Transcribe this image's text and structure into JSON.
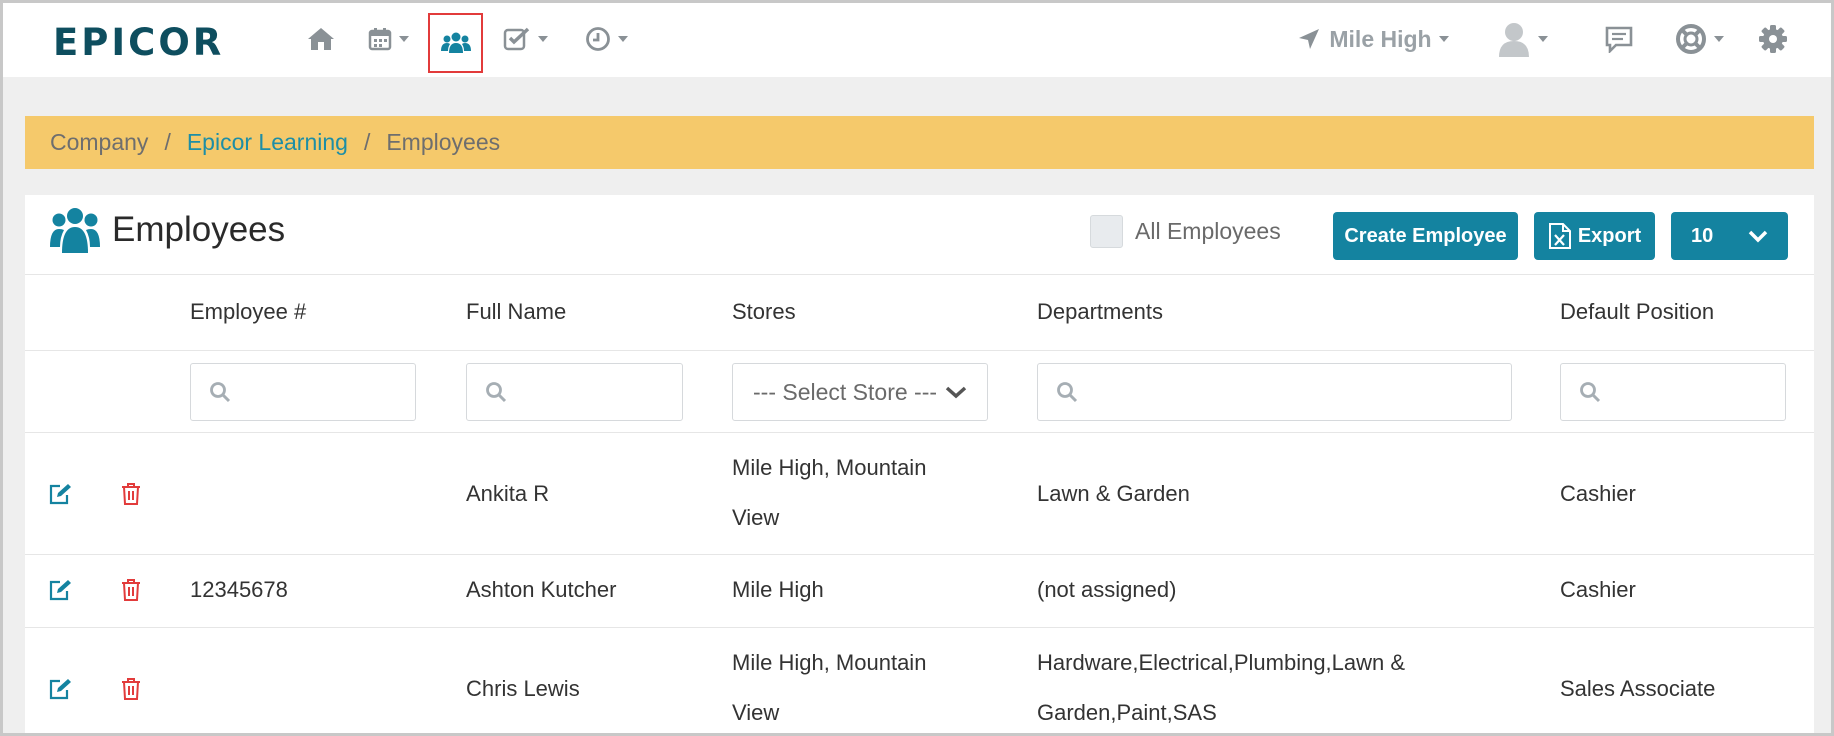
{
  "navbar": {
    "logo": "EPICOR",
    "store": "Mile High",
    "icons": [
      "home-icon",
      "calendar-icon",
      "users-icon",
      "tasks-icon",
      "clock-icon",
      "location-arrow-icon",
      "user-avatar-icon",
      "chat-icon",
      "support-icon",
      "gear-icon"
    ]
  },
  "breadcrumb": {
    "items": [
      "Company",
      "Epicor Learning",
      "Employees"
    ]
  },
  "panel": {
    "title": "Employees",
    "all_employees_label": "All Employees",
    "create_label": "Create Employee",
    "export_label": "Export",
    "page_size": "10"
  },
  "table": {
    "columns": [
      "Employee #",
      "Full Name",
      "Stores",
      "Departments",
      "Default Position"
    ],
    "store_filter_placeholder": "--- Select Store ---",
    "rows": [
      {
        "employee_no": "",
        "full_name": "Ankita R",
        "stores_line1": "Mile High, Mountain",
        "stores_line2": "View",
        "departments_line1": "Lawn & Garden",
        "departments_line2": "",
        "position": "Cashier"
      },
      {
        "employee_no": "12345678",
        "full_name": "Ashton Kutcher",
        "stores_line1": "Mile High",
        "stores_line2": "",
        "departments_line1": "(not assigned)",
        "departments_line2": "",
        "position": "Cashier"
      },
      {
        "employee_no": "",
        "full_name": "Chris Lewis",
        "stores_line1": "Mile High, Mountain",
        "stores_line2": "View",
        "departments_line1": "Hardware,Electrical,Plumbing,Lawn &",
        "departments_line2": "Garden,Paint,SAS",
        "position": "Sales Associate"
      }
    ]
  },
  "colors": {
    "accent": "#1483a0",
    "breadcrumb_bg": "#f5c96b",
    "delete": "#e23b3b",
    "logo": "#0e4e5f"
  }
}
